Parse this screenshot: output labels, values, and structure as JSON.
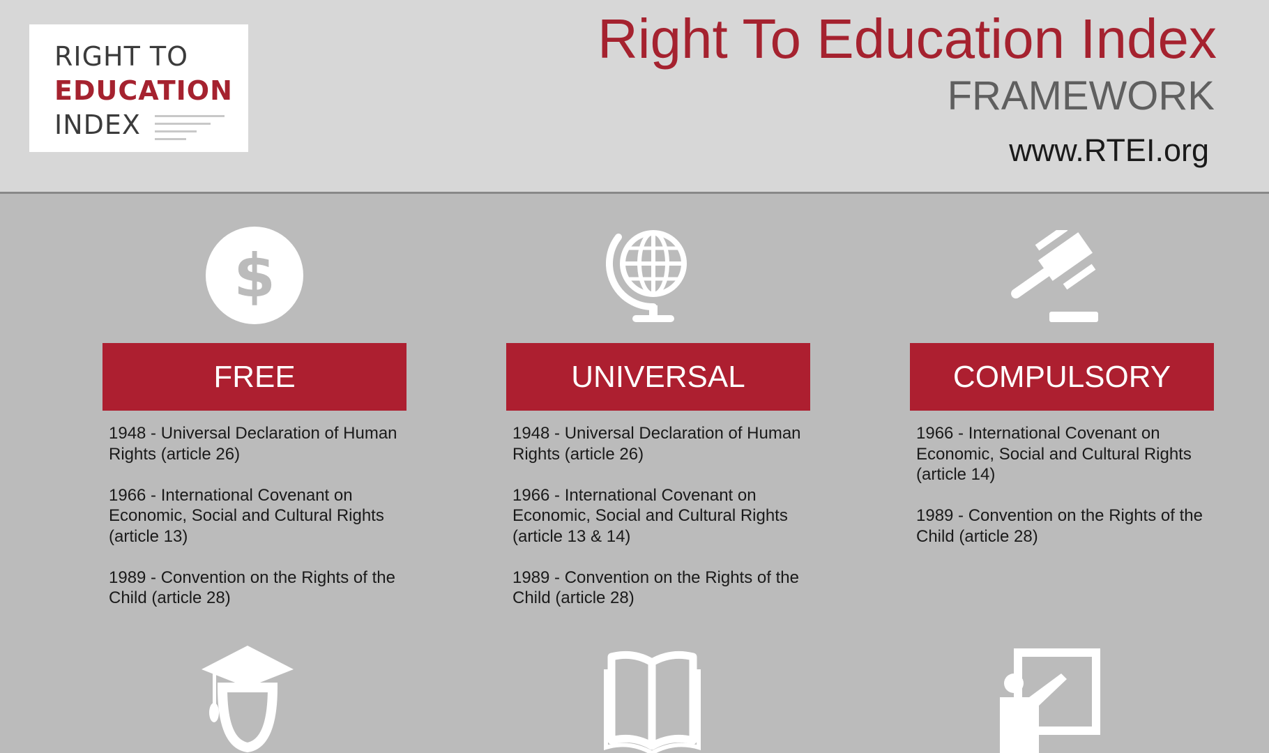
{
  "logo": {
    "line1": "RIGHT TO",
    "line2": "EDUCATION",
    "line3": "INDEX"
  },
  "header": {
    "title": "Right To Education Index",
    "subtitle": "FRAMEWORK",
    "website": "www.RTEI.org"
  },
  "columns": [
    {
      "icon": "dollar-icon",
      "label": "FREE",
      "items": [
        "1948 - Universal Declaration of Human Rights (article 26)",
        "1966 - International Covenant on Economic, Social and Cultural Rights (article 13)",
        "1989 - Convention on the Rights of the Child (article 28)"
      ]
    },
    {
      "icon": "globe-icon",
      "label": "UNIVERSAL",
      "items": [
        "1948 - Universal Declaration of Human Rights (article 26)",
        "1966 - International Covenant on Economic, Social and Cultural Rights (article 13 & 14)",
        "1989 - Convention on the Rights of the Child (article 28)"
      ]
    },
    {
      "icon": "gavel-icon",
      "label": "COMPULSORY",
      "items": [
        "1966 - International Covenant on Economic, Social and Cultural Rights (article 14)",
        "1989 - Convention on the Rights of the Child (article 28)"
      ]
    }
  ],
  "bottom_icons": [
    "graduate-icon",
    "open-book-icon",
    "teacher-board-icon"
  ],
  "colors": {
    "accent": "#ad1f30",
    "header_bg": "#d7d7d7",
    "body_bg": "#bbbbbb",
    "icon": "#ffffff"
  }
}
